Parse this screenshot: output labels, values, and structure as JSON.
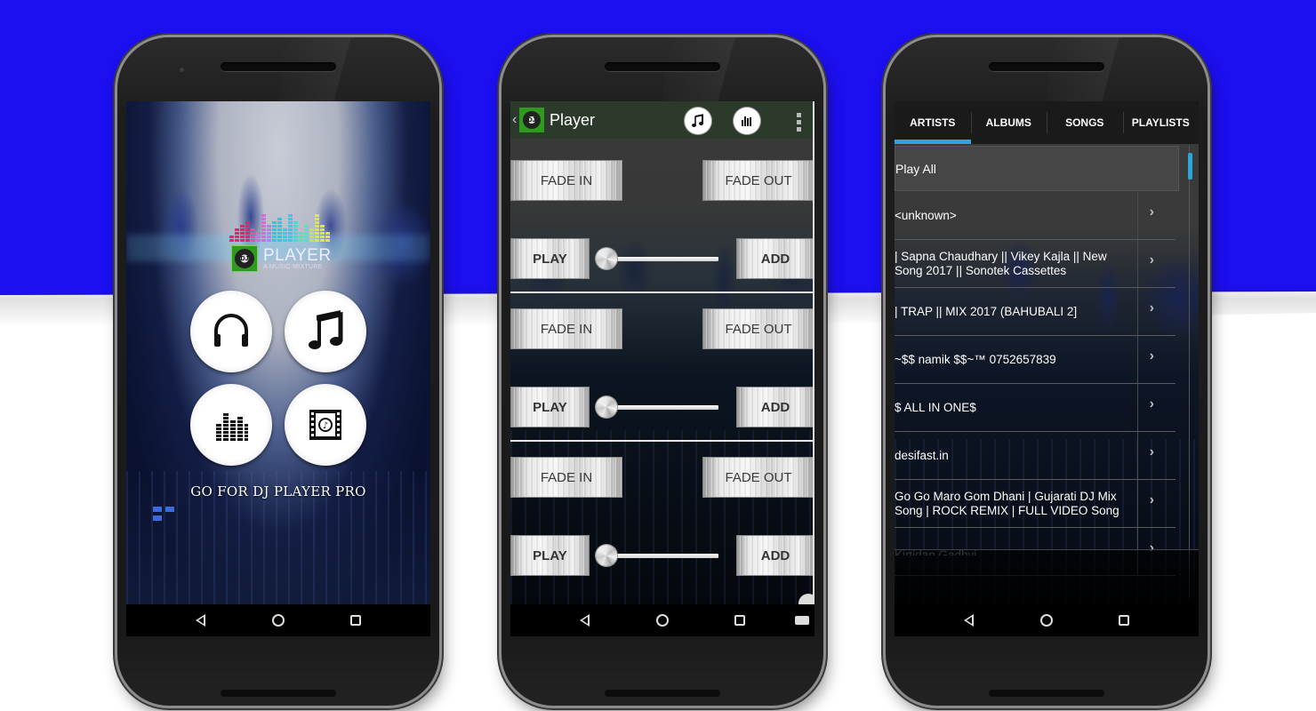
{
  "background": {
    "accent_color": "#1c0ff0"
  },
  "phone_home": {
    "logo": {
      "title": "PLAYER",
      "subtitle": "A MUSIC MIXTURE",
      "badge": "DJ",
      "eq_colors": [
        "#e8246e",
        "#e8246e",
        "#e84fa0",
        "#d76bd8",
        "#b47ff0",
        "#2fc6ea",
        "#2fd0e6",
        "#3fe0d0",
        "#52e6b0",
        "#b6ea4f",
        "#d8ea3f",
        "#e6e63a"
      ]
    },
    "menu": [
      {
        "name": "headphones",
        "icon": "headphones-icon"
      },
      {
        "name": "songs",
        "icon": "music-note-icon"
      },
      {
        "name": "equalizer",
        "icon": "equalizer-icon"
      },
      {
        "name": "video",
        "icon": "film-music-icon"
      }
    ],
    "promo_text": "GO FOR DJ PLAYER PRO"
  },
  "phone_player": {
    "appbar": {
      "title": "Player",
      "badge": "DJ"
    },
    "decks": [
      {
        "fade_in": "FADE IN",
        "fade_out": "FADE OUT",
        "play": "PLAY",
        "add": "ADD",
        "slider_value": 0
      },
      {
        "fade_in": "FADE IN",
        "fade_out": "FADE OUT",
        "play": "PLAY",
        "add": "ADD",
        "slider_value": 0
      },
      {
        "fade_in": "FADE IN",
        "fade_out": "FADE OUT",
        "play": "PLAY",
        "add": "ADD",
        "slider_value": 0
      }
    ]
  },
  "phone_library": {
    "tabs": [
      {
        "label": "ARTISTS",
        "active": true
      },
      {
        "label": "ALBUMS",
        "active": false
      },
      {
        "label": "SONGS",
        "active": false
      },
      {
        "label": "PLAYLISTS",
        "active": false
      }
    ],
    "play_all": "Play All",
    "artists": [
      "<unknown>",
      "| Sapna Chaudhary || Vikey Kajla || New Song 2017 || Sonotek Cassettes",
      "| TRAP || MIX 2017 (BAHUBALI 2]",
      "~$$ namik $$~™  0752657839",
      "$ ALL IN ONE$",
      "desifast.in",
      "Go Go Maro Gom Dhani | Gujarati DJ Mix Song | ROCK REMIX | FULL VIDEO Song",
      "Kirtidan Gadhvi"
    ],
    "accent_color": "#2aa6df"
  }
}
